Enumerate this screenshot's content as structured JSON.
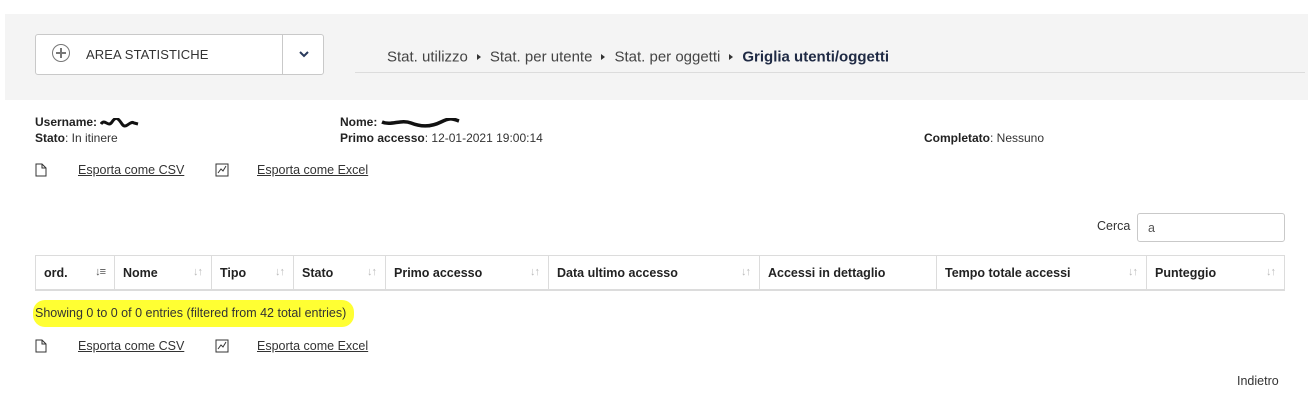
{
  "area_select": {
    "label": "AREA STATISTICHE"
  },
  "breadcrumb": {
    "items": [
      "Stat. utilizzo",
      "Stat. per utente",
      "Stat. per oggetti"
    ],
    "current": "Griglia utenti/oggetti"
  },
  "info": {
    "username_label": "Username",
    "stato_label": "Stato",
    "stato_value": "In itinere",
    "nome_label": "Nome",
    "primo_accesso_label": "Primo accesso",
    "primo_accesso_value": "12-01-2021 19:00:14",
    "completato_label": "Completato",
    "completato_value": "Nessuno"
  },
  "export": {
    "csv": "Esporta come CSV",
    "excel": "Esporta come Excel"
  },
  "search": {
    "label": "Cerca",
    "value": "a"
  },
  "table": {
    "columns": [
      "ord.",
      "Nome",
      "Tipo",
      "Stato",
      "Primo accesso",
      "Data ultimo accesso",
      "Accessi in dettaglio",
      "Tempo totale accessi",
      "Punteggio"
    ]
  },
  "entries_info": "Showing 0 to 0 of 0 entries (filtered from 42 total entries)",
  "back_label": "Indietro",
  "colors": {
    "highlight": "#ffff33",
    "breadcrumb_current": "#1f2a44",
    "band": "#f4f4f4"
  }
}
